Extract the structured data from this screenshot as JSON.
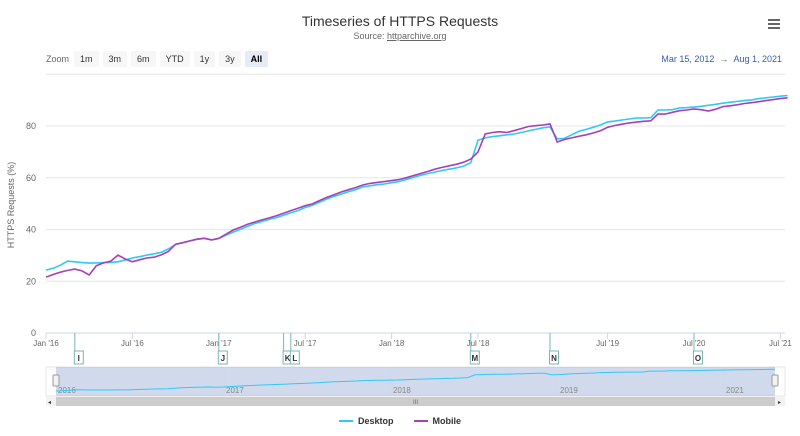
{
  "title": "Timeseries of HTTPS Requests",
  "subtitle_prefix": "Source: ",
  "subtitle_link": "httparchive.org",
  "menu_icon": "hamburger-menu-icon",
  "zoom": {
    "label": "Zoom",
    "buttons": [
      "1m",
      "3m",
      "6m",
      "YTD",
      "1y",
      "3y",
      "All"
    ],
    "active": "All"
  },
  "range": {
    "from": "Mar 15, 2012",
    "arrow": "→",
    "to": "Aug 1, 2021"
  },
  "chart_data": {
    "type": "line",
    "title": "Timeseries of HTTPS Requests",
    "ylabel": "HTTPS Requests (%)",
    "ylim": [
      0,
      100
    ],
    "yticks": [
      "0",
      "20",
      "40",
      "60",
      "80"
    ],
    "xticks": [
      "Jan '16",
      "Jul '16",
      "Jan '17",
      "Jul '17",
      "Jan '18",
      "Jul '18",
      "Jul '19",
      "Jul '20",
      "Jul '21"
    ],
    "x_axis_ordinal": true,
    "grid": true,
    "legend": "bottom-center",
    "x": [
      "2016-01-01",
      "2016-01-15",
      "2016-02-01",
      "2016-02-15",
      "2016-03-01",
      "2016-03-15",
      "2016-04-01",
      "2016-04-15",
      "2016-05-01",
      "2016-05-15",
      "2016-06-01",
      "2016-06-15",
      "2016-07-01",
      "2016-07-15",
      "2016-08-01",
      "2016-08-15",
      "2016-09-01",
      "2016-09-15",
      "2016-10-01",
      "2016-10-15",
      "2016-11-01",
      "2016-11-15",
      "2016-12-01",
      "2016-12-15",
      "2017-01-01",
      "2017-01-15",
      "2017-02-01",
      "2017-02-15",
      "2017-03-01",
      "2017-03-15",
      "2017-04-01",
      "2017-04-15",
      "2017-05-01",
      "2017-05-15",
      "2017-06-01",
      "2017-06-15",
      "2017-07-01",
      "2017-07-15",
      "2017-08-01",
      "2017-08-15",
      "2017-09-01",
      "2017-09-15",
      "2017-10-01",
      "2017-10-15",
      "2017-11-01",
      "2017-11-15",
      "2017-12-01",
      "2017-12-15",
      "2018-01-01",
      "2018-01-15",
      "2018-02-01",
      "2018-02-15",
      "2018-03-01",
      "2018-03-15",
      "2018-04-01",
      "2018-04-15",
      "2018-05-01",
      "2018-05-15",
      "2018-06-01",
      "2018-06-15",
      "2018-07-01",
      "2018-07-15",
      "2018-08-01",
      "2018-08-15",
      "2018-09-01",
      "2018-09-15",
      "2018-10-01",
      "2018-10-15",
      "2018-11-01",
      "2018-11-15",
      "2018-12-01",
      "2018-12-15",
      "2019-01-01",
      "2019-02-01",
      "2019-03-01",
      "2019-04-01",
      "2019-05-01",
      "2019-06-01",
      "2019-07-01",
      "2019-08-01",
      "2019-09-01",
      "2019-10-01",
      "2019-11-01",
      "2019-12-01",
      "2020-01-01",
      "2020-02-01",
      "2020-03-01",
      "2020-04-01",
      "2020-05-01",
      "2020-06-01",
      "2020-07-01",
      "2020-08-01",
      "2020-09-01",
      "2020-10-01",
      "2020-11-01",
      "2020-12-01",
      "2021-01-01",
      "2021-02-01",
      "2021-03-01",
      "2021-04-01",
      "2021-05-01",
      "2021-06-01",
      "2021-07-01",
      "2021-08-01"
    ],
    "series": [
      {
        "name": "Desktop",
        "color": "#2fc9f5",
        "values": [
          24.3,
          25.0,
          26.2,
          27.8,
          27.5,
          27.2,
          27.0,
          27.1,
          27.2,
          27.3,
          27.5,
          28.2,
          29.0,
          29.5,
          30.1,
          30.6,
          31.2,
          32.5,
          34.2,
          34.9,
          35.6,
          36.2,
          36.6,
          36.0,
          36.5,
          37.8,
          39.0,
          40.1,
          41.2,
          42.3,
          43.1,
          43.9,
          44.6,
          45.5,
          46.5,
          47.3,
          48.5,
          49.4,
          50.6,
          51.8,
          52.8,
          53.7,
          54.6,
          55.4,
          56.5,
          56.9,
          57.3,
          57.6,
          58.1,
          58.5,
          59.3,
          60.1,
          60.9,
          61.6,
          62.2,
          62.8,
          63.3,
          63.8,
          64.5,
          65.8,
          74.5,
          75.4,
          75.9,
          76.2,
          76.6,
          76.9,
          77.5,
          78.1,
          78.7,
          79.3,
          79.6,
          75.0,
          75.2,
          76.6,
          77.9,
          78.7,
          79.5,
          80.4,
          81.6,
          81.9,
          82.3,
          82.7,
          83.1,
          83.1,
          83.2,
          86.2,
          86.2,
          86.3,
          87.0,
          87.1,
          87.3,
          87.6,
          88.0,
          88.4,
          88.8,
          89.2,
          89.5,
          89.8,
          90.1,
          90.6,
          90.9,
          91.2,
          91.5,
          91.8
        ]
      },
      {
        "name": "Mobile",
        "color": "#a83fb8",
        "values": [
          21.6,
          22.6,
          23.5,
          24.2,
          24.7,
          24.0,
          22.4,
          26.0,
          27.1,
          27.8,
          30.1,
          28.6,
          27.5,
          28.3,
          29.0,
          29.3,
          30.2,
          31.5,
          34.3,
          34.9,
          35.6,
          36.3,
          36.6,
          36.0,
          36.6,
          38.2,
          39.8,
          40.9,
          42.0,
          42.9,
          43.7,
          44.5,
          45.3,
          46.3,
          47.3,
          48.2,
          49.2,
          49.9,
          51.2,
          52.4,
          53.4,
          54.5,
          55.4,
          56.2,
          57.2,
          57.8,
          58.2,
          58.5,
          58.9,
          59.3,
          60.0,
          60.8,
          61.6,
          62.4,
          63.3,
          64.0,
          64.6,
          65.2,
          66.0,
          67.2,
          70.0,
          76.9,
          77.5,
          77.8,
          77.5,
          78.2,
          79.0,
          79.8,
          80.1,
          80.4,
          80.8,
          73.8,
          74.8,
          75.4,
          76.0,
          76.6,
          77.3,
          78.2,
          79.5,
          80.2,
          80.7,
          81.2,
          81.5,
          81.8,
          82.0,
          84.6,
          84.6,
          85.3,
          85.9,
          86.2,
          86.6,
          86.3,
          85.8,
          86.5,
          87.5,
          87.8,
          88.2,
          88.7,
          89.0,
          89.4,
          89.8,
          90.2,
          90.6,
          90.9
        ]
      }
    ],
    "flags": [
      {
        "title": "I",
        "date": "2016-03-01"
      },
      {
        "title": "J",
        "date": "2017-01-01"
      },
      {
        "title": "K",
        "date": "2017-05-15"
      },
      {
        "title": "L",
        "date": "2017-06-01"
      },
      {
        "title": "M",
        "date": "2018-06-15"
      },
      {
        "title": "N",
        "date": "2018-12-01"
      },
      {
        "title": "O",
        "date": "2020-07-01"
      }
    ],
    "navigator_labels": [
      "2016",
      "2017",
      "2018",
      "2019",
      "2021"
    ]
  }
}
